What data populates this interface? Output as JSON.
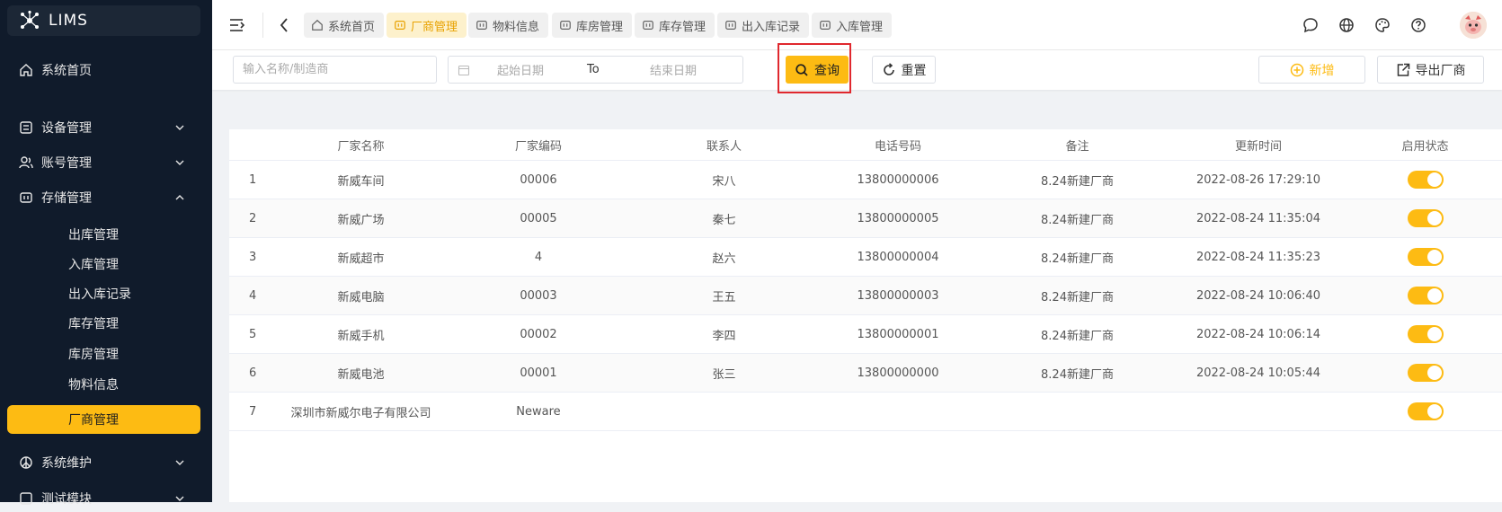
{
  "app": {
    "title": "LIMS"
  },
  "sidebar": {
    "home": "系统首页",
    "device": "设备管理",
    "account": "账号管理",
    "storage": "存储管理",
    "storage_children": [
      "出库管理",
      "入库管理",
      "出入库记录",
      "库存管理",
      "库房管理",
      "物料信息",
      "厂商管理"
    ],
    "active_child": "厂商管理",
    "maintenance": "系统维护",
    "test": "测试模块"
  },
  "tabs": [
    {
      "label": "系统首页",
      "icon": "home-icon",
      "active": false
    },
    {
      "label": "厂商管理",
      "icon": "vendor-icon",
      "active": true
    },
    {
      "label": "物料信息",
      "icon": "material-icon",
      "active": false
    },
    {
      "label": "库房管理",
      "icon": "warehouse-icon",
      "active": false
    },
    {
      "label": "库存管理",
      "icon": "inventory-icon",
      "active": false
    },
    {
      "label": "出入库记录",
      "icon": "record-icon",
      "active": false
    },
    {
      "label": "入库管理",
      "icon": "inbound-icon",
      "active": false
    }
  ],
  "filters": {
    "name_placeholder": "输入名称/制造商",
    "start_placeholder": "起始日期",
    "to_label": "To",
    "end_placeholder": "结束日期",
    "query_label": "查询",
    "reset_label": "重置",
    "add_label": "新增",
    "export_label": "导出厂商"
  },
  "table": {
    "headers": [
      "",
      "厂家名称",
      "厂家编码",
      "联系人",
      "电话号码",
      "备注",
      "更新时间",
      "启用状态"
    ],
    "rows": [
      {
        "idx": "1",
        "name": "新威车间",
        "code": "00006",
        "contact": "宋八",
        "phone": "13800000006",
        "remark": "8.24新建厂商",
        "updated": "2022-08-26 17:29:10",
        "enabled": true
      },
      {
        "idx": "2",
        "name": "新威广场",
        "code": "00005",
        "contact": "秦七",
        "phone": "13800000005",
        "remark": "8.24新建厂商",
        "updated": "2022-08-24 11:35:04",
        "enabled": true
      },
      {
        "idx": "3",
        "name": "新威超市",
        "code": "4",
        "contact": "赵六",
        "phone": "13800000004",
        "remark": "8.24新建厂商",
        "updated": "2022-08-24 11:35:23",
        "enabled": true
      },
      {
        "idx": "4",
        "name": "新威电脑",
        "code": "00003",
        "contact": "王五",
        "phone": "13800000003",
        "remark": "8.24新建厂商",
        "updated": "2022-08-24 10:06:40",
        "enabled": true
      },
      {
        "idx": "5",
        "name": "新威手机",
        "code": "00002",
        "contact": "李四",
        "phone": "13800000001",
        "remark": "8.24新建厂商",
        "updated": "2022-08-24 10:06:14",
        "enabled": true
      },
      {
        "idx": "6",
        "name": "新威电池",
        "code": "00001",
        "contact": "张三",
        "phone": "13800000000",
        "remark": "8.24新建厂商",
        "updated": "2022-08-24 10:05:44",
        "enabled": true
      },
      {
        "idx": "7",
        "name": "深圳市新威尔电子有限公司",
        "code": "Neware",
        "contact": "",
        "phone": "",
        "remark": "",
        "updated": "",
        "enabled": true
      }
    ]
  },
  "colors": {
    "accent": "#fdbb13",
    "sidebar_bg": "#101b2b",
    "highlight": "#e0282e"
  }
}
